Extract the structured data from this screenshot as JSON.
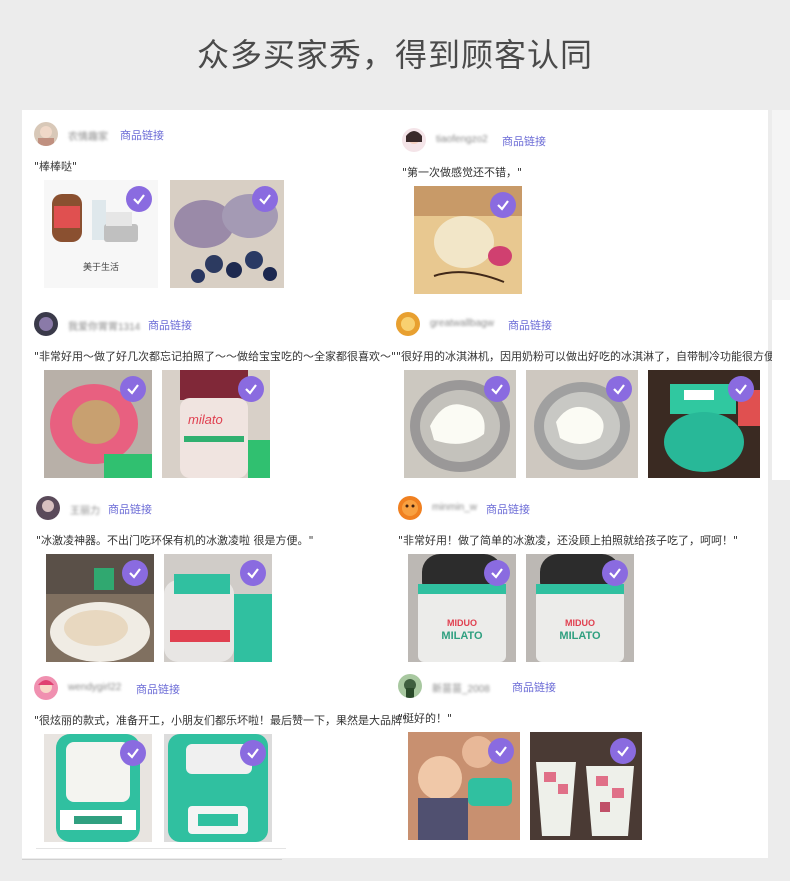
{
  "header": {
    "title": "众多买家秀，得到顾客认同"
  },
  "reviews": [
    {
      "user": "农情趣家",
      "link": "商品链接",
      "comment": "\"棒棒哒\"",
      "photos": [
        {
          "caption": "美于生活",
          "check": "verified-check"
        },
        {
          "check": "verified-check"
        }
      ]
    },
    {
      "user": "tiaofengzo2",
      "link": "商品链接",
      "comment": "\"第一次做感觉还不错，\"",
      "photos": [
        {
          "check": "verified-check"
        }
      ]
    },
    {
      "user": "我爱你胃胃1314",
      "link": "商品链接",
      "comment": "\"非常好用～做了好几次都忘记拍照了～～做给宝宝吃的～全家都很喜欢～\"",
      "photos": [
        {
          "check": "verified-check"
        },
        {
          "brand": "milato",
          "check": "verified-check"
        }
      ]
    },
    {
      "user": "greatwallbagw",
      "link": "商品链接",
      "comment": "\"很好用的冰淇淋机，因用奶粉可以做出好吃的冰淇淋了，自带制冷功能很方便。\"",
      "photos": [
        {
          "check": "verified-check"
        },
        {
          "check": "verified-check"
        },
        {
          "check": "verified-check"
        }
      ]
    },
    {
      "user": "王丽力",
      "link": "商品链接",
      "comment": "\"冰激凌神器。不出门吃环保有机的冰激凌啦 很是方便。\"",
      "photos": [
        {
          "check": "verified-check"
        },
        {
          "check": "verified-check"
        }
      ]
    },
    {
      "user": "minmin_w",
      "link": "商品链接",
      "comment": "\"非常好用！做了简单的冰激凌，还没顾上拍照就给孩子吃了，呵呵！\"",
      "photos": [
        {
          "brand_top": "MIDUO",
          "brand": "MILATO",
          "check": "verified-check"
        },
        {
          "brand_top": "MIDUO",
          "brand": "MILATO",
          "check": "verified-check"
        }
      ]
    },
    {
      "user": "wendygirl22",
      "link": "商品链接",
      "comment": "\"很炫丽的款式，准备开工，小朋友们都乐坏啦！最后赞一下，果然是大品牌\"",
      "photos": [
        {
          "check": "verified-check"
        },
        {
          "check": "verified-check"
        }
      ]
    },
    {
      "user": "新苗苗_2008",
      "link": "商品链接",
      "comment": "\"挺好的！\"",
      "photos": [
        {
          "check": "verified-check"
        },
        {
          "check": "verified-check"
        }
      ]
    }
  ],
  "colors": {
    "accent": "#8a6be0",
    "link": "#6b6bd6",
    "background": "#ececec"
  }
}
